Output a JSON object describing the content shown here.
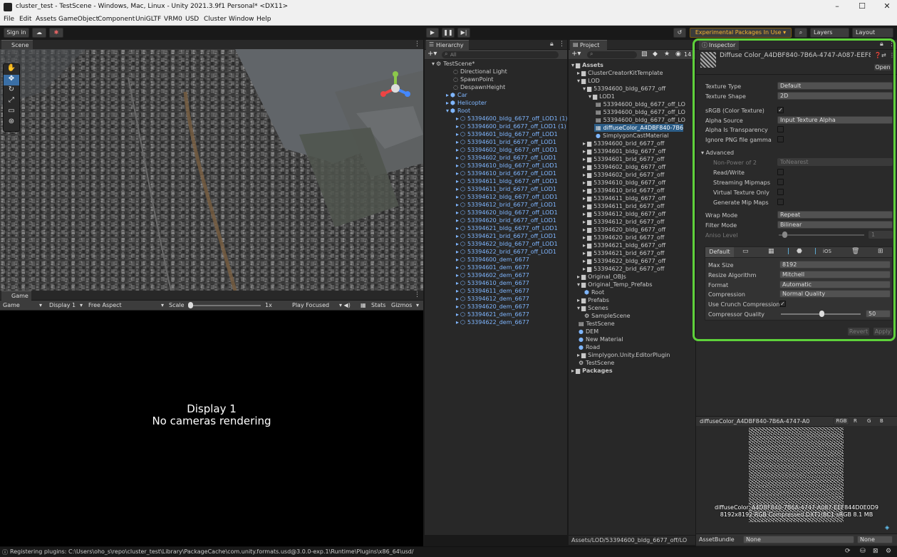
{
  "window": {
    "title": "cluster_test - TestScene - Windows, Mac, Linux - Unity 2021.3.9f1 Personal* <DX11>",
    "controls": [
      "–",
      "☐",
      "✕"
    ]
  },
  "menu": [
    "File",
    "Edit",
    "Assets",
    "GameObject",
    "Component",
    "UniGLTF",
    "VRM0",
    "USD",
    "Cluster",
    "Window",
    "Help"
  ],
  "toolbar": {
    "sign_in": "Sign in",
    "experimental": "Experimental Packages In Use ▾",
    "layers": "Layers",
    "layout": "Layout"
  },
  "scene": {
    "tab": "Scene",
    "btn_2d": "2D"
  },
  "game": {
    "tab": "Game",
    "display": "Display 1",
    "aspect": "Free Aspect",
    "scale_label": "Scale",
    "scale_value": "1x",
    "play_mode": "Play Focused",
    "stats": "Stats",
    "gizmos": "Gizmos",
    "display_label": "Display 1",
    "no_cameras": "No cameras rendering"
  },
  "hierarchy": {
    "tab": "Hierarchy",
    "search": "All",
    "scene": "TestScene*",
    "top_items": [
      "Directional Light",
      "SpawnPoint",
      "DespawnHeight"
    ],
    "groups": [
      "Car",
      "Helicopter",
      "Root"
    ],
    "root_children": [
      "53394600_bldg_6677_off_LOD1 (1)",
      "53394600_brid_6677_off_LOD1 (1)",
      "53394601_bldg_6677_off_LOD1",
      "53394601_brid_6677_off_LOD1",
      "53394602_bldg_6677_off_LOD1",
      "53394602_brid_6677_off_LOD1",
      "53394610_bldg_6677_off_LOD1",
      "53394610_brid_6677_off_LOD1",
      "53394611_bldg_6677_off_LOD1",
      "53394611_brid_6677_off_LOD1",
      "53394612_bldg_6677_off_LOD1",
      "53394612_brid_6677_off_LOD1",
      "53394620_bldg_6677_off_LOD1",
      "53394620_brid_6677_off_LOD1",
      "53394621_bldg_6677_off_LOD1",
      "53394621_brid_6677_off_LOD1",
      "53394622_bldg_6677_off_LOD1",
      "53394622_brid_6677_off_LOD1",
      "53394600_dem_6677",
      "53394601_dem_6677",
      "53394602_dem_6677",
      "53394610_dem_6677",
      "53394611_dem_6677",
      "53394612_dem_6677",
      "53394620_dem_6677",
      "53394621_dem_6677",
      "53394622_dem_6677"
    ]
  },
  "project": {
    "tab": "Project",
    "count": "14",
    "path": "Assets/LOD/53394600_bldg_6677_off/LO",
    "tree": [
      {
        "t": "Assets",
        "d": 0,
        "k": "folder",
        "b": true
      },
      {
        "t": "ClusterCreatorKitTemplate",
        "d": 1,
        "k": "folder"
      },
      {
        "t": "LOD",
        "d": 1,
        "k": "folder"
      },
      {
        "t": "53394600_bldg_6677_off",
        "d": 2,
        "k": "folder"
      },
      {
        "t": "LOD1",
        "d": 3,
        "k": "folder"
      },
      {
        "t": "53394600_bldg_6677_off_LO",
        "d": 4,
        "k": "file"
      },
      {
        "t": "53394600_bldg_6677_off_LO",
        "d": 4,
        "k": "file"
      },
      {
        "t": "53394600_bldg_6677_off_LO",
        "d": 4,
        "k": "file"
      },
      {
        "t": "diffuseColor_A4DBF840-7B6",
        "d": 4,
        "k": "tex",
        "s": true
      },
      {
        "t": "SimplygonCastMaterial",
        "d": 4,
        "k": "mat"
      },
      {
        "t": "53394600_brid_6677_off",
        "d": 2,
        "k": "folder"
      },
      {
        "t": "53394601_bldg_6677_off",
        "d": 2,
        "k": "folder"
      },
      {
        "t": "53394601_brid_6677_off",
        "d": 2,
        "k": "folder"
      },
      {
        "t": "53394602_bldg_6677_off",
        "d": 2,
        "k": "folder"
      },
      {
        "t": "53394602_brid_6677_off",
        "d": 2,
        "k": "folder"
      },
      {
        "t": "53394610_bldg_6677_off",
        "d": 2,
        "k": "folder"
      },
      {
        "t": "53394610_brid_6677_off",
        "d": 2,
        "k": "folder"
      },
      {
        "t": "53394611_bldg_6677_off",
        "d": 2,
        "k": "folder"
      },
      {
        "t": "53394611_brid_6677_off",
        "d": 2,
        "k": "folder"
      },
      {
        "t": "53394612_bldg_6677_off",
        "d": 2,
        "k": "folder"
      },
      {
        "t": "53394612_brid_6677_off",
        "d": 2,
        "k": "folder"
      },
      {
        "t": "53394620_bldg_6677_off",
        "d": 2,
        "k": "folder"
      },
      {
        "t": "53394620_brid_6677_off",
        "d": 2,
        "k": "folder"
      },
      {
        "t": "53394621_bldg_6677_off",
        "d": 2,
        "k": "folder"
      },
      {
        "t": "53394621_brid_6677_off",
        "d": 2,
        "k": "folder"
      },
      {
        "t": "53394622_bldg_6677_off",
        "d": 2,
        "k": "folder"
      },
      {
        "t": "53394622_brid_6677_off",
        "d": 2,
        "k": "folder"
      },
      {
        "t": "Original_OBJs",
        "d": 1,
        "k": "folder"
      },
      {
        "t": "Original_Temp_Prefabs",
        "d": 1,
        "k": "folder"
      },
      {
        "t": "Root",
        "d": 2,
        "k": "prefab"
      },
      {
        "t": "Prefabs",
        "d": 1,
        "k": "folder"
      },
      {
        "t": "Scenes",
        "d": 1,
        "k": "folder"
      },
      {
        "t": "SampleScene",
        "d": 2,
        "k": "unity"
      },
      {
        "t": "TestScene",
        "d": 1,
        "k": "file"
      },
      {
        "t": "DEM",
        "d": 1,
        "k": "mat"
      },
      {
        "t": "New Material",
        "d": 1,
        "k": "mat"
      },
      {
        "t": "Road",
        "d": 1,
        "k": "mat"
      },
      {
        "t": "Simplygon.Unity.EditorPlugin",
        "d": 1,
        "k": "folder"
      },
      {
        "t": "TestScene",
        "d": 1,
        "k": "unity"
      },
      {
        "t": "Packages",
        "d": 0,
        "k": "folder",
        "b": true
      }
    ]
  },
  "inspector": {
    "tab": "Inspector",
    "asset_name": "Diffuse Color_A4DBF840-7B6A-4747-A087-EEF8",
    "open": "Open",
    "texture_type": {
      "label": "Texture Type",
      "value": "Default"
    },
    "texture_shape": {
      "label": "Texture Shape",
      "value": "2D"
    },
    "srgb": {
      "label": "sRGB (Color Texture)",
      "checked": "✓"
    },
    "alpha_source": {
      "label": "Alpha Source",
      "value": "Input Texture Alpha"
    },
    "alpha_transparency": "Alpha Is Transparency",
    "ignore_png": "Ignore PNG file gamma",
    "advanced": "Advanced",
    "non_power": {
      "label": "Non-Power of 2",
      "value": "ToNearest"
    },
    "read_write": "Read/Write",
    "streaming": "Streaming Mipmaps",
    "virtual": "Virtual Texture Only",
    "generate_mip": "Generate Mip Maps",
    "wrap_mode": {
      "label": "Wrap Mode",
      "value": "Repeat"
    },
    "filter_mode": {
      "label": "Filter Mode",
      "value": "Bilinear"
    },
    "aniso": {
      "label": "Aniso Level",
      "value": "1"
    },
    "platform_default": "Default",
    "max_size": {
      "label": "Max Size",
      "value": "8192"
    },
    "resize": {
      "label": "Resize Algorithm",
      "value": "Mitchell"
    },
    "format": {
      "label": "Format",
      "value": "Automatic"
    },
    "compression": {
      "label": "Compression",
      "value": "Normal Quality"
    },
    "crunch": {
      "label": "Use Crunch Compression",
      "checked": "✓"
    },
    "comp_quality": {
      "label": "Compressor Quality",
      "value": "50"
    },
    "revert": "Revert",
    "apply": "Apply",
    "preview_title": "diffuseColor_A4DBF840-7B6A-4747-A0",
    "channels": [
      "RGB",
      "R",
      "G",
      "B"
    ],
    "preview_name": "diffuseColor_A4DBF840-7B6A-4747-A087-EEF844D0E0D9",
    "preview_info": "8192x8192  RGB Compressed DXT1|BC1 sRGB  8.1 MB",
    "asset_bundle": {
      "label": "AssetBundle",
      "value": "None",
      "variant": "None"
    },
    "accent": "#5ed13a"
  },
  "status": "Registering plugins: C:\\Users\\oho_s\\repo\\cluster_test\\Library\\PackageCache\\com.unity.formats.usd@3.0.0-exp.1\\Runtime\\Plugins\\x86_64\\usd/"
}
